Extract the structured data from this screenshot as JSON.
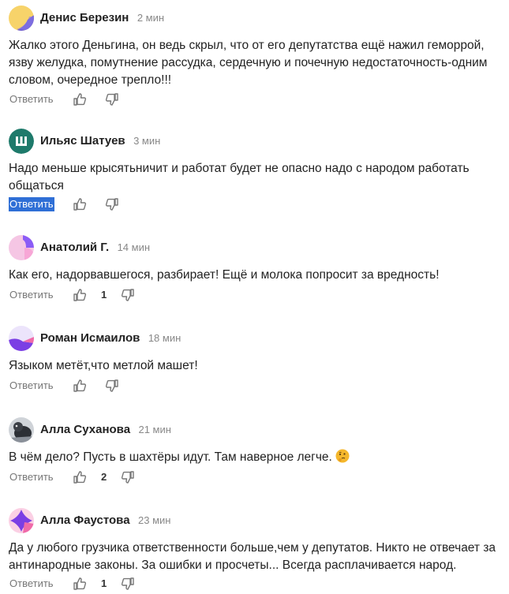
{
  "comments": [
    {
      "author": "Денис Березин",
      "time": "2 мин",
      "text": "Жалко этого Деньгина, он ведь скрыл, что от его депутатства ещё нажил геморрой, язву желудка, помутнение рассудка, сердечную и почечную недостаточность-одним словом, очередное трепло!!!",
      "reply": "Ответить",
      "likes": ""
    },
    {
      "author": "Ильяс Шатуев",
      "time": "3 мин",
      "text": "Надо меньше крысятьничит и работат будет не опасно надо с народом работать общаться",
      "reply": "Ответить",
      "likes": ""
    },
    {
      "author": "Анатолий Г.",
      "time": "14 мин",
      "text": "Как его, надорвавшегося, разбирает! Ещё и молока попросит за вредность!",
      "reply": "Ответить",
      "likes": "1"
    },
    {
      "author": "Роман Исмаилов",
      "time": "18 мин",
      "text": "Языком метёт,что метлой машет!",
      "reply": "Ответить",
      "likes": ""
    },
    {
      "author": "Алла Суханова",
      "time": "21 мин",
      "text": "В чём дело? Пусть в шахтёры идут. Там наверное легче.",
      "reply": "Ответить",
      "likes": "2"
    },
    {
      "author": "Алла Фаустова",
      "time": "23 мин",
      "text": "Да у любого грузчика ответственности больше,чем у депутатов. Никто не отвечает за антинародные законы. За ошибки и просчеты... Всегда расплачивается народ.",
      "reply": "Ответить",
      "likes": "1"
    }
  ],
  "icons": {
    "like": "thumbs-up-icon",
    "dislike": "thumbs-down-icon",
    "emoji": "thinking-face-emoji"
  },
  "colors": {
    "selected_reply_bg": "#2f6fd6",
    "avatar_teal": "#1e7a6b"
  }
}
